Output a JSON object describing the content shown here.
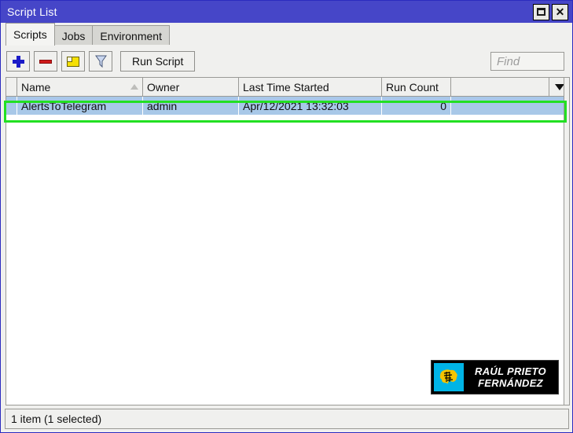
{
  "window": {
    "title": "Script List",
    "controls": [
      {
        "name": "maximize-button",
        "icon": "maximize-icon",
        "label": ""
      },
      {
        "name": "close-button",
        "icon": "close-icon",
        "label": "✕"
      }
    ]
  },
  "tabs": [
    {
      "label": "Scripts",
      "active": true
    },
    {
      "label": "Jobs",
      "active": false
    },
    {
      "label": "Environment",
      "active": false
    }
  ],
  "toolbar": {
    "add_label": "",
    "remove_label": "",
    "comment_label": "",
    "filter_label": "",
    "run_script_label": "Run Script"
  },
  "search": {
    "value": "",
    "placeholder": "Find"
  },
  "table": {
    "columns": [
      {
        "key": "name",
        "label": "Name",
        "sort": "asc"
      },
      {
        "key": "owner",
        "label": "Owner",
        "sort": ""
      },
      {
        "key": "last_time_started",
        "label": "Last Time Started",
        "sort": ""
      },
      {
        "key": "run_count",
        "label": "Run Count",
        "sort": ""
      }
    ],
    "rows": [
      {
        "name": "AlertsToTelegram",
        "owner": "admin",
        "last_time_started": "Apr/12/2021 13:32:03",
        "run_count": "0",
        "selected": true
      }
    ]
  },
  "badge": {
    "line1": "RAÚL PRIETO",
    "line2": "FERNÁNDEZ"
  },
  "statusbar": {
    "text": "1 item (1 selected)"
  },
  "colors": {
    "titlebar": "#4646c8",
    "selection_row": "#a8c8e8",
    "highlight_border": "#22e022",
    "accent_add": "#1b1bc8",
    "accent_remove": "#d01a1a",
    "badge_logo_bg": "#00b4e6"
  }
}
